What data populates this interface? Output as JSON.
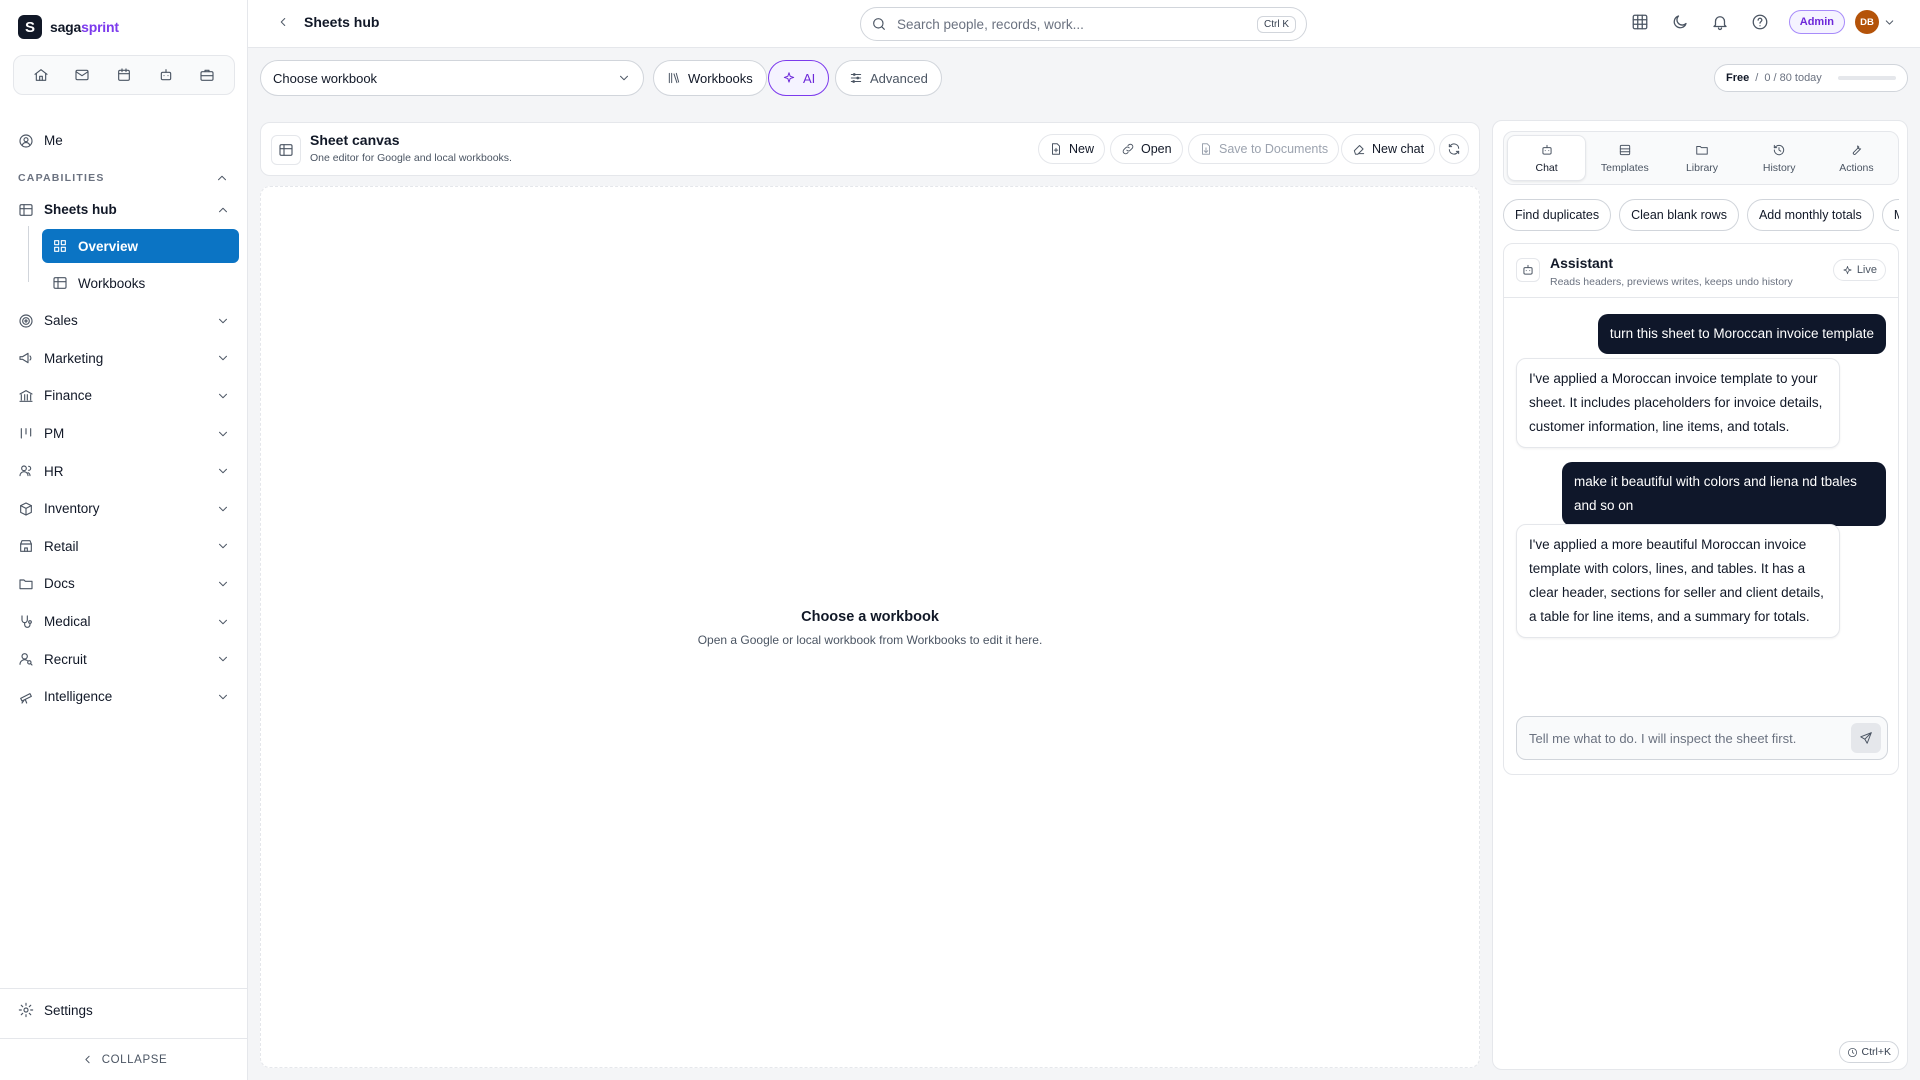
{
  "brand": {
    "mark": "S",
    "name_part1": "saga",
    "name_part2": "sprint",
    "accent": "#7c3aed"
  },
  "sidebar": {
    "quick_icons": [
      "home-icon",
      "mail-icon",
      "calendar-icon",
      "bot-icon",
      "briefcase-icon"
    ],
    "me_label": "Me",
    "capabilities_label": "CAPABILITIES",
    "sheets_hub_label": "Sheets hub",
    "sub_items": [
      {
        "label": "Overview",
        "icon": "grid-icon",
        "active": true
      },
      {
        "label": "Workbooks",
        "icon": "table-icon",
        "active": false
      }
    ],
    "sections": [
      {
        "label": "Sales",
        "icon": "target-icon"
      },
      {
        "label": "Marketing",
        "icon": "megaphone-icon"
      },
      {
        "label": "Finance",
        "icon": "bank-icon"
      },
      {
        "label": "PM",
        "icon": "kanban-icon"
      },
      {
        "label": "HR",
        "icon": "users-icon"
      },
      {
        "label": "Inventory",
        "icon": "box-icon"
      },
      {
        "label": "Retail",
        "icon": "store-icon"
      },
      {
        "label": "Docs",
        "icon": "folder-icon"
      },
      {
        "label": "Medical",
        "icon": "stethoscope-icon"
      },
      {
        "label": "Recruit",
        "icon": "user-search-icon"
      },
      {
        "label": "Intelligence",
        "icon": "telescope-icon"
      }
    ],
    "settings_label": "Settings",
    "collapse_label": "COLLAPSE",
    "active_color": "#0b74c4"
  },
  "topbar": {
    "breadcrumb": "Sheets hub",
    "search_placeholder": "Search people, records, work...",
    "search_shortcut": "Ctrl K",
    "admin_label": "Admin",
    "avatar_initials": "DB"
  },
  "toolbar": {
    "workbook_select": "Choose workbook",
    "workbooks_btn": "Workbooks",
    "ai_btn": "AI",
    "advanced_btn": "Advanced",
    "quota_plan": "Free",
    "quota_sep": "/",
    "quota_text": "0 / 80 today",
    "quota_fraction": 0
  },
  "canvas": {
    "title": "Sheet canvas",
    "subtitle": "One editor for Google and local workbooks.",
    "new_btn": "New",
    "open_btn": "Open",
    "save_btn": "Save to Documents",
    "new_chat_btn": "New chat",
    "empty_title": "Choose a workbook",
    "empty_sub": "Open a Google or local workbook from Workbooks to edit it here."
  },
  "panel": {
    "tabs": [
      {
        "label": "Chat",
        "icon": "bot-icon",
        "active": true
      },
      {
        "label": "Templates",
        "icon": "layout-icon",
        "active": false
      },
      {
        "label": "Library",
        "icon": "folder-icon",
        "active": false
      },
      {
        "label": "History",
        "icon": "history-icon",
        "active": false
      },
      {
        "label": "Actions",
        "icon": "wrench-icon",
        "active": false
      }
    ],
    "chips": [
      "Find duplicates",
      "Clean blank rows",
      "Add monthly totals",
      "Merge sheets"
    ],
    "assistant_name": "Assistant",
    "assistant_desc": "Reads headers, previews writes, keeps undo history",
    "live_label": "Live",
    "messages": [
      {
        "role": "user",
        "text": "turn this sheet to Moroccan invoice template"
      },
      {
        "role": "bot",
        "text": "I've applied a Moroccan invoice template to your sheet. It includes placeholders for invoice details, customer information, line items, and totals."
      },
      {
        "role": "user",
        "text": "make it beautiful with colors and liena nd tbales and so on"
      },
      {
        "role": "bot",
        "text": "I've applied a more beautiful Moroccan invoice template with colors, lines, and tables. It has a clear header, sections for seller and client details, a table for line items, and a summary for totals."
      }
    ],
    "composer_placeholder": "Tell me what to do. I will inspect the sheet first.",
    "help_shortcut": "Ctrl+K"
  }
}
